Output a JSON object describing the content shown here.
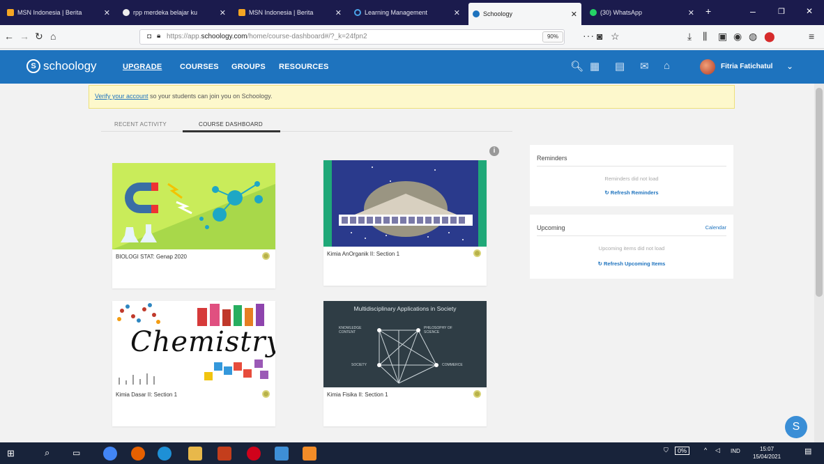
{
  "browser": {
    "tabs": [
      {
        "title": "MSN Indonesia | Berita",
        "icon": "msn-icon",
        "color": "#f5a623"
      },
      {
        "title": "rpp merdeka belajar ku",
        "icon": "chrome-icon",
        "color": "#eeeeee"
      },
      {
        "title": "MSN Indonesia | Berita",
        "icon": "msn-icon",
        "color": "#f5a623"
      },
      {
        "title": "Learning Management",
        "icon": "circle-icon",
        "color": "#4aa3e8"
      },
      {
        "title": "Schoology",
        "icon": "schoology-icon",
        "color": "#1e73be"
      },
      {
        "title": "(30) WhatsApp",
        "icon": "whatsapp-icon",
        "color": "#25d366"
      }
    ],
    "url_prefix": "https://app.",
    "url_domain": "schoology.com",
    "url_path": "/home/course-dashboard#/?_k=24fpn2",
    "zoom": "90%"
  },
  "header": {
    "logo": "schoology",
    "nav": [
      "UPGRADE",
      "COURSES",
      "GROUPS",
      "RESOURCES"
    ],
    "username": "Fitria Fatichatul"
  },
  "notice": {
    "link": "Verify your account",
    "text": " so your students can join you on Schoology."
  },
  "page_tabs": [
    "RECENT ACTIVITY",
    "COURSE DASHBOARD"
  ],
  "courses": [
    {
      "title": "BIOLOGI STAT: Genap 2020"
    },
    {
      "title": "Kimia AnOrganik II: Section 1"
    },
    {
      "title": "Kimia Dasar II: Section 1",
      "image_text": "Chemistry"
    },
    {
      "title": "Kimia Fisika II: Section 1",
      "image_text": "Multidisciplinary Applications in Society",
      "nodes": [
        "KNOWLEDGE CONTENT",
        "PHILOSOPHY OF SCIENCE",
        "SOCIETY",
        "COMMERCE"
      ]
    }
  ],
  "reminders": {
    "title": "Reminders",
    "message": "Reminders did not load",
    "refresh": "Refresh Reminders"
  },
  "upcoming": {
    "title": "Upcoming",
    "calendar": "Calendar",
    "message": "Upcoming items did not load",
    "refresh": "Refresh Upcoming Items"
  },
  "chat_letter": "S",
  "taskbar": {
    "battery": "0%",
    "lang": "IND",
    "time": "15:07",
    "date": "15/04/2021"
  }
}
